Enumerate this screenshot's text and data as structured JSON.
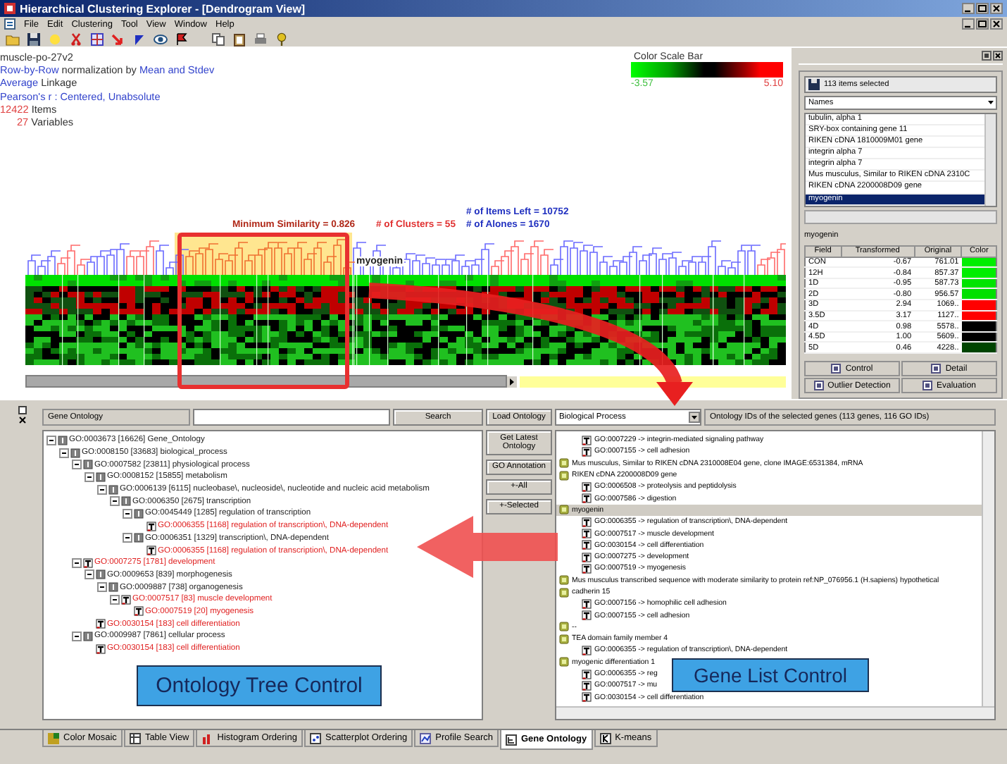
{
  "window": {
    "title": "Hierarchical Clustering Explorer - [Dendrogram View]"
  },
  "menu": [
    "File",
    "Edit",
    "Clustering",
    "Tool",
    "View",
    "Window",
    "Help"
  ],
  "view": {
    "info": [
      {
        "parts": [
          {
            "text": "muscle-po-27v2",
            "kind": "label"
          }
        ]
      },
      {
        "parts": [
          {
            "text": "Row-by-Row",
            "kind": "setting"
          },
          {
            "text": " normalization by ",
            "kind": "label"
          },
          {
            "text": "Mean and Stdev",
            "kind": "setting"
          }
        ]
      },
      {
        "parts": [
          {
            "text": "Average",
            "kind": "setting"
          },
          {
            "text": " Linkage",
            "kind": "label"
          }
        ]
      },
      {
        "parts": [
          {
            "text": "Pearson's r : Centered, Unabsolute",
            "kind": "setting"
          }
        ]
      },
      {
        "parts": [
          {
            "text": "12422",
            "kind": "count"
          },
          {
            "text": " Items",
            "kind": "label"
          }
        ]
      },
      {
        "parts": [
          {
            "text": "27",
            "kind": "count"
          },
          {
            "text": " Variables",
            "kind": "label"
          }
        ]
      }
    ],
    "color_scale": {
      "title": "Color Scale Bar",
      "min": "-3.57",
      "max": "5.10"
    },
    "stats": {
      "items_left": "# of Items Left = 10752",
      "min_similarity": "Minimum Similarity = 0.826",
      "clusters": "# of Clusters = 55",
      "alones": "# of Alones = 1670"
    },
    "marker_label": "myogenin"
  },
  "detail": {
    "count_label": "113 items selected",
    "column": "Names",
    "items": [
      {
        "text": "tubulin, alpha 1",
        "selected": false
      },
      {
        "text": "SRY-box containing gene 11",
        "selected": false
      },
      {
        "text": "RIKEN cDNA 1810009M01 gene",
        "selected": false
      },
      {
        "text": "integrin alpha 7",
        "selected": false
      },
      {
        "text": "integrin alpha 7",
        "selected": false
      },
      {
        "text": "Mus musculus, Similar to RIKEN cDNA 2310C",
        "selected": false
      },
      {
        "text": "RIKEN cDNA 2200008D09 gene",
        "selected": false
      },
      {
        "text": "myogenin",
        "selected": true
      }
    ],
    "item_label": "myogenin",
    "table": {
      "columns": [
        "Field",
        "Transformed",
        "Original",
        "Color"
      ],
      "rows": [
        {
          "field": "CON",
          "transformed": "-0.67",
          "original": "761.01",
          "color": "#00ee00"
        },
        {
          "field": "12H",
          "transformed": "-0.84",
          "original": "857.37",
          "color": "#00ee00"
        },
        {
          "field": "1D",
          "transformed": "-0.95",
          "original": "587.73",
          "color": "#00e400"
        },
        {
          "field": "2D",
          "transformed": "-0.80",
          "original": "956.57",
          "color": "#00e000"
        },
        {
          "field": "3D",
          "transformed": "2.94",
          "original": "1069..",
          "color": "#ff0000"
        },
        {
          "field": "3.5D",
          "transformed": "3.17",
          "original": "1127..",
          "color": "#ff0000"
        },
        {
          "field": "4D",
          "transformed": "0.98",
          "original": "5578..",
          "color": "#000000"
        },
        {
          "field": "4.5D",
          "transformed": "1.00",
          "original": "5609..",
          "color": "#000000"
        },
        {
          "field": "5D",
          "transformed": "0.46",
          "original": "4228..",
          "color": "#004400"
        }
      ]
    },
    "tabs": [
      "Control",
      "Detail",
      "Outlier Detection",
      "Evaluation"
    ]
  },
  "ontology": {
    "title": "Gene Ontology",
    "search_button": "Search",
    "tree": [
      {
        "text": "GO:0003673 [16626] Gene_Ontology",
        "kind": "term",
        "highlighted": false,
        "expanded": true,
        "children": [
          {
            "text": "GO:0008150 [33683] biological_process",
            "kind": "term",
            "highlighted": false,
            "expanded": true,
            "children": [
              {
                "text": "GO:0007582 [23811] physiological process",
                "kind": "term",
                "highlighted": false,
                "expanded": true,
                "children": [
                  {
                    "text": "GO:0008152 [15855] metabolism",
                    "kind": "term",
                    "highlighted": false,
                    "expanded": true,
                    "children": [
                      {
                        "text": "GO:0006139 [6115] nucleobase\\, nucleoside\\, nucleotide and nucleic acid metabolism",
                        "kind": "term",
                        "highlighted": false,
                        "expanded": true,
                        "children": [
                          {
                            "text": "GO:0006350 [2675] transcription",
                            "kind": "term",
                            "highlighted": false,
                            "expanded": true,
                            "children": [
                              {
                                "text": "GO:0045449 [1285] regulation of transcription",
                                "kind": "term",
                                "highlighted": false,
                                "expanded": true,
                                "children": [
                                  {
                                    "text": "GO:0006355 [1168] regulation of transcription\\, DNA-dependent",
                                    "kind": "annotated",
                                    "highlighted": true
                                  }
                                ]
                              },
                              {
                                "text": "GO:0006351 [1329] transcription\\, DNA-dependent",
                                "kind": "term",
                                "highlighted": false,
                                "expanded": true,
                                "children": [
                                  {
                                    "text": "GO:0006355 [1168] regulation of transcription\\, DNA-dependent",
                                    "kind": "annotated",
                                    "highlighted": true
                                  }
                                ]
                              }
                            ]
                          }
                        ]
                      }
                    ]
                  }
                ]
              },
              {
                "text": "GO:0007275 [1781] development",
                "kind": "annotated",
                "highlighted": true,
                "expanded": true,
                "children": [
                  {
                    "text": "GO:0009653 [839] morphogenesis",
                    "kind": "term",
                    "highlighted": false,
                    "expanded": true,
                    "children": [
                      {
                        "text": "GO:0009887 [738] organogenesis",
                        "kind": "term",
                        "highlighted": false,
                        "expanded": true,
                        "children": [
                          {
                            "text": "GO:0007517 [83] muscle development",
                            "kind": "annotated",
                            "highlighted": true,
                            "expanded": true,
                            "children": [
                              {
                                "text": "GO:0007519 [20] myogenesis",
                                "kind": "annotated",
                                "highlighted": true
                              }
                            ]
                          }
                        ]
                      }
                    ]
                  },
                  {
                    "text": "GO:0030154 [183] cell differentiation",
                    "kind": "annotated",
                    "highlighted": true
                  }
                ]
              },
              {
                "text": "GO:0009987 [7861] cellular process",
                "kind": "term",
                "highlighted": false,
                "expanded": true,
                "children": [
                  {
                    "text": "GO:0030154 [183] cell differentiation",
                    "kind": "annotated",
                    "highlighted": true
                  }
                ]
              }
            ]
          }
        ]
      }
    ],
    "buttons": [
      "Load Ontology",
      "Get Latest Ontology",
      "GO Annotation",
      "+-All",
      "+-Selected"
    ],
    "category": "Biological Process",
    "list_caption": "Ontology IDs of the selected genes (113 genes, 116 GO IDs)",
    "genes": [
      {
        "kind": "go",
        "text": "GO:0007229 -> integrin-mediated signaling pathway",
        "selected": false
      },
      {
        "kind": "go",
        "text": "GO:0007155 -> cell adhesion",
        "selected": false
      },
      {
        "kind": "gene",
        "text": "Mus musculus, Similar to RIKEN cDNA 2310008E04 gene, clone IMAGE:6531384, mRNA",
        "selected": false
      },
      {
        "kind": "gene",
        "text": "RIKEN cDNA 2200008D09 gene",
        "selected": false
      },
      {
        "kind": "go",
        "text": "GO:0006508 -> proteolysis and peptidolysis",
        "selected": false
      },
      {
        "kind": "go",
        "text": "GO:0007586 -> digestion",
        "selected": false
      },
      {
        "kind": "gene",
        "text": "myogenin",
        "selected": true
      },
      {
        "kind": "go",
        "text": "GO:0006355 -> regulation of transcription\\, DNA-dependent",
        "selected": false
      },
      {
        "kind": "go",
        "text": "GO:0007517 -> muscle development",
        "selected": false
      },
      {
        "kind": "go",
        "text": "GO:0030154 -> cell differentiation",
        "selected": false
      },
      {
        "kind": "go",
        "text": "GO:0007275 -> development",
        "selected": false
      },
      {
        "kind": "go",
        "text": "GO:0007519 -> myogenesis",
        "selected": false
      },
      {
        "kind": "gene",
        "text": "Mus musculus transcribed sequence with moderate similarity to protein ref:NP_076956.1 (H.sapiens) hypothetical",
        "selected": false
      },
      {
        "kind": "gene",
        "text": "cadherin 15",
        "selected": false
      },
      {
        "kind": "go",
        "text": "GO:0007156 -> homophilic cell adhesion",
        "selected": false
      },
      {
        "kind": "go",
        "text": "GO:0007155 -> cell adhesion",
        "selected": false
      },
      {
        "kind": "gene",
        "text": "--",
        "selected": false
      },
      {
        "kind": "gene",
        "text": "TEA domain family member 4",
        "selected": false
      },
      {
        "kind": "go",
        "text": "GO:0006355 -> regulation of transcription\\, DNA-dependent",
        "selected": false
      },
      {
        "kind": "gene",
        "text": "myogenic differentiation 1",
        "selected": false
      },
      {
        "kind": "go",
        "text": "GO:0006355 -> reg",
        "selected": false
      },
      {
        "kind": "go",
        "text": "GO:0007517 -> mu",
        "selected": false
      },
      {
        "kind": "go",
        "text": "GO:0030154 -> cell differentiation",
        "selected": false
      }
    ]
  },
  "callouts": {
    "tree": "Ontology Tree Control",
    "list": "Gene List Control"
  },
  "bottom_tabs": [
    {
      "label": "Color Mosaic",
      "selected": false
    },
    {
      "label": "Table View",
      "selected": false
    },
    {
      "label": "Histogram Ordering",
      "selected": false
    },
    {
      "label": "Scatterplot Ordering",
      "selected": false
    },
    {
      "label": "Profile Search",
      "selected": false
    },
    {
      "label": "Gene Ontology",
      "selected": true
    },
    {
      "label": "K-means",
      "selected": false
    }
  ]
}
